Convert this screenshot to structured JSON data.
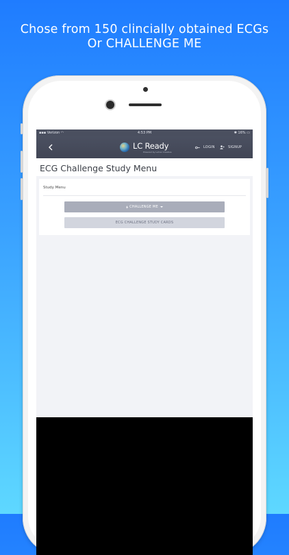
{
  "headline": {
    "line1": "Chose from 150 clincially obtained ECGs",
    "line2": "Or CHALLENGE ME"
  },
  "statusbar": {
    "carrier": "Verizon",
    "time": "4:53 PM",
    "battery": "16%"
  },
  "navbar": {
    "logo_text": "LC Ready",
    "logo_subtext": "Powered by Lehrer Creative",
    "login_label": "LOGIN",
    "signup_label": "SIGNUP"
  },
  "page": {
    "title": "ECG Challenge Study Menu"
  },
  "card": {
    "title": "Study Menu",
    "challenge_button": "CHALLENGE ME",
    "study_cards_button": "ECG CHALLENGE STUDY CARDS"
  },
  "colors": {
    "background_top": "#1f7cff",
    "background_bottom": "#5ed8ff",
    "navbar": "#454a59",
    "primary_button": "#a9adba",
    "secondary_button": "#d2d5de"
  },
  "icons": {
    "back": "chevron-left-icon",
    "login": "key-icon",
    "signup": "user-plus-icon",
    "challenge": "bolt-icon"
  }
}
